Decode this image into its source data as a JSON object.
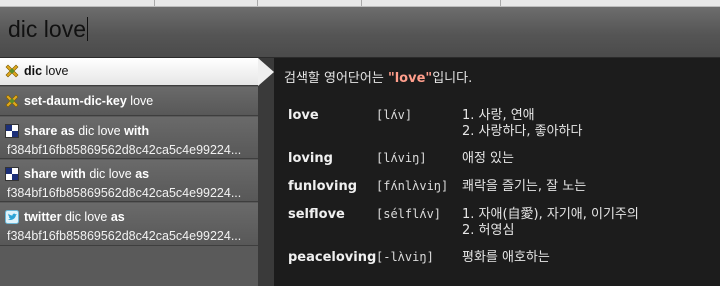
{
  "search": {
    "query": "dic love"
  },
  "results": [
    {
      "cmd": "dic",
      "arg": "love",
      "line2": "",
      "icon": "plugin-icon",
      "selected": true
    },
    {
      "cmd": "set-daum-dic-key",
      "arg": "love",
      "line2": "",
      "icon": "plugin-icon",
      "selected": false
    },
    {
      "cmd": "share as",
      "arg": "dic love",
      "cmd2": "with",
      "line2": "f384bf16fb85869562d8c42ca5c4e99224...",
      "icon": "share-icon",
      "selected": false
    },
    {
      "cmd": "share with",
      "arg": "dic love",
      "cmd2": "as",
      "line2": "f384bf16fb85869562d8c42ca5c4e99224...",
      "icon": "share-icon",
      "selected": false
    },
    {
      "cmd": "twitter",
      "arg": "dic love",
      "cmd2": "as",
      "line2": "f384bf16fb85869562d8c42ca5c4e99224...",
      "icon": "twitter-icon",
      "selected": false
    }
  ],
  "preview": {
    "header_pre": "검색할 영어단어는 ",
    "header_query": "\"love\"",
    "header_post": "입니다.",
    "entries": [
      {
        "word": "love",
        "pron": "[lʌ́v]",
        "meaning": [
          "1. 사랑, 연애",
          "2. 사랑하다, 좋아하다"
        ]
      },
      {
        "word": "loving",
        "pron": "[lʌ́viŋ]",
        "meaning": [
          "애정 있는"
        ]
      },
      {
        "word": "funloving",
        "pron": "[fʌ́nlʌ̀viŋ]",
        "meaning": [
          "쾌락을 즐기는, 잘 노는"
        ]
      },
      {
        "word": "selflove",
        "pron": "[sélflʌ́v]",
        "meaning": [
          "1. 자애(自愛), 자기애, 이기주의",
          "2. 허영심"
        ]
      },
      {
        "word": "peaceloving",
        "pron": "[-lʌ̀viŋ]",
        "meaning": [
          "평화를 애호하는"
        ]
      }
    ]
  }
}
